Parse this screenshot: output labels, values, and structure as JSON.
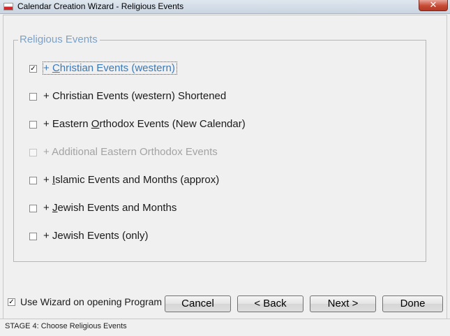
{
  "window": {
    "title": "Calendar Creation Wizard - Religious Events",
    "close_symbol": "✕"
  },
  "group": {
    "legend": "Religious Events",
    "options": [
      {
        "prefix": "+ ",
        "mnemonic": "C",
        "rest": "hristian Events (western)",
        "checked": true,
        "enabled": true,
        "focused": true
      },
      {
        "prefix": "+ ",
        "mnemonic": "",
        "rest": "Christian Events (western) Shortened",
        "checked": false,
        "enabled": true,
        "focused": false
      },
      {
        "prefix": "+ Eastern ",
        "mnemonic": "O",
        "rest": "rthodox Events (New Calendar)",
        "checked": false,
        "enabled": true,
        "focused": false
      },
      {
        "prefix": "+ Additional Eastern Orthodox Events",
        "mnemonic": "",
        "rest": "",
        "checked": false,
        "enabled": false,
        "focused": false
      },
      {
        "prefix": "+ ",
        "mnemonic": "I",
        "rest": "slamic Events and Months (approx)",
        "checked": false,
        "enabled": true,
        "focused": false
      },
      {
        "prefix": "+ ",
        "mnemonic": "J",
        "rest": "ewish Events and Months",
        "checked": false,
        "enabled": true,
        "focused": false
      },
      {
        "prefix": "+ Jewish Events (only)",
        "mnemonic": "",
        "rest": "",
        "checked": false,
        "enabled": true,
        "focused": false
      }
    ]
  },
  "footer": {
    "use_wizard_label": "Use Wizard on opening Program",
    "use_wizard_checked": true,
    "check_mark": "✓",
    "cancel_label": "Cancel",
    "back_label": "< Back",
    "next_label": "Next >",
    "done_label": "Done"
  },
  "status": {
    "text": "STAGE 4: Choose Religious Events"
  }
}
